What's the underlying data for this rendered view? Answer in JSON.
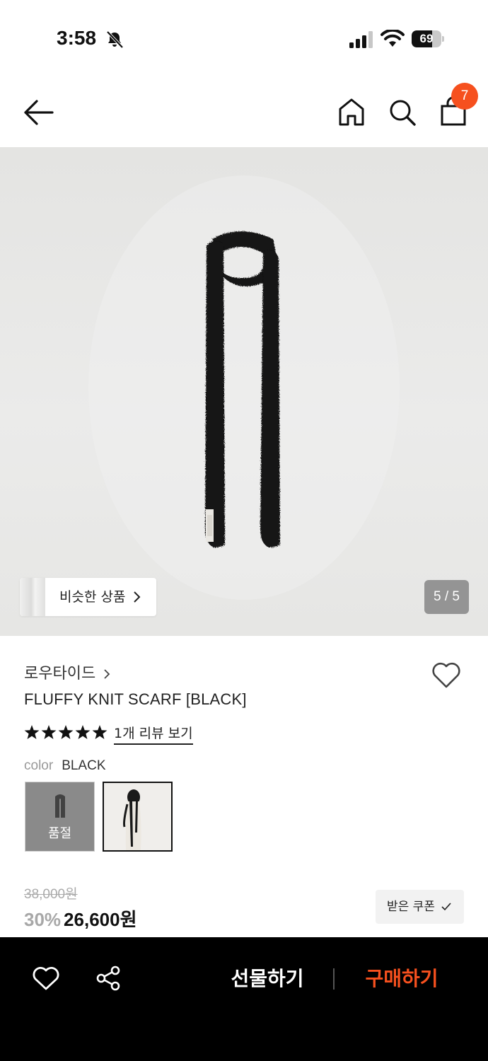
{
  "status_bar": {
    "time": "3:58",
    "battery_level": "69",
    "battery_fraction": 0.69,
    "icons": [
      "bell-muted-icon",
      "signal-icon",
      "wifi-icon",
      "battery-icon"
    ]
  },
  "header": {
    "icons": [
      "arrow-left-icon",
      "home-icon",
      "search-icon",
      "shopping-bag-icon"
    ],
    "cart_count": "7"
  },
  "gallery": {
    "similar_label": "비슷한 상품",
    "page_indicator": "5 / 5"
  },
  "product": {
    "brand": "로우타이드",
    "title": "FLUFFY KNIT SCARF [BLACK]",
    "rating_stars": 5,
    "review_link": "1개 리뷰 보기",
    "color_label": "color",
    "color_value": "BLACK",
    "swatches": [
      {
        "status": "품절"
      },
      {
        "status": ""
      }
    ]
  },
  "price": {
    "original": "38,000원",
    "discount": "30%",
    "sale": "26,600원",
    "coupon_label": "받은 쿠폰"
  },
  "bottom_bar": {
    "gift_label": "선물하기",
    "buy_label": "구매하기",
    "colors": {
      "buy": "#f6501e",
      "background": "#000000"
    }
  },
  "colors": {
    "accent": "#f6501e",
    "text": "#222222",
    "muted": "#999999"
  }
}
